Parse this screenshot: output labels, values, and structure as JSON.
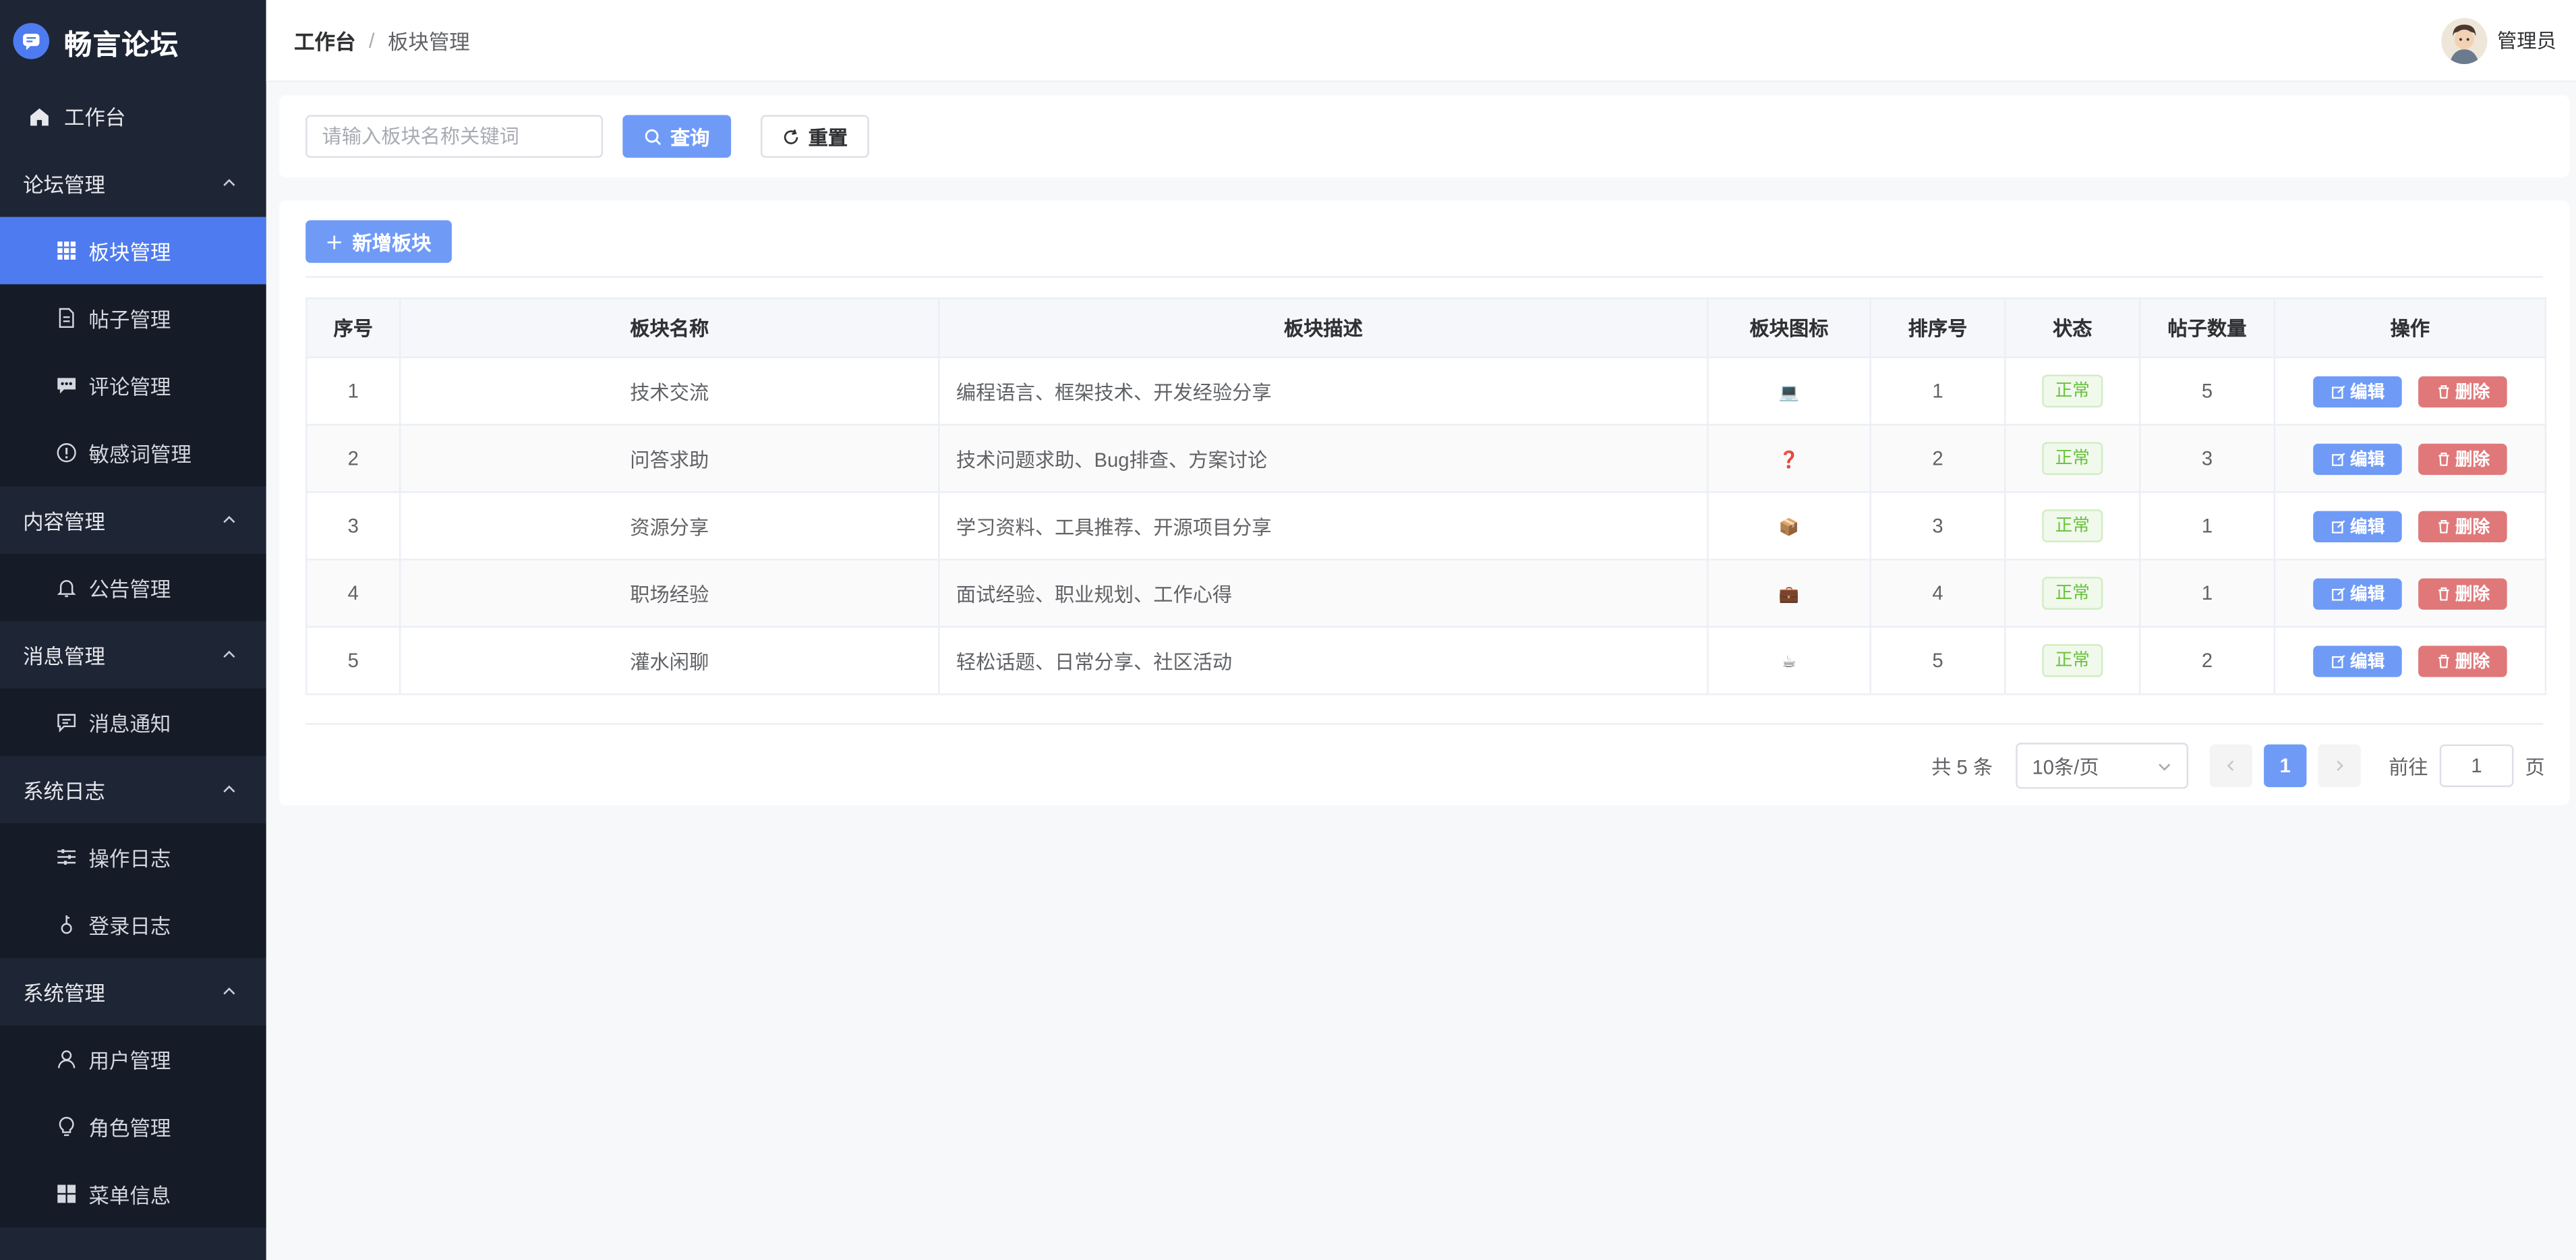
{
  "app": {
    "title": "畅言论坛",
    "brand_color": "#4f7bf0"
  },
  "sidebar": {
    "top_item": {
      "label": "工作台",
      "icon": "home-icon"
    },
    "groups": [
      {
        "label": "论坛管理",
        "items": [
          {
            "label": "板块管理",
            "icon": "grid-icon",
            "active": true
          },
          {
            "label": "帖子管理",
            "icon": "document-icon"
          },
          {
            "label": "评论管理",
            "icon": "comment-icon"
          },
          {
            "label": "敏感词管理",
            "icon": "warning-icon"
          }
        ]
      },
      {
        "label": "内容管理",
        "items": [
          {
            "label": "公告管理",
            "icon": "bell-icon"
          }
        ]
      },
      {
        "label": "消息管理",
        "items": [
          {
            "label": "消息通知",
            "icon": "message-icon"
          }
        ]
      },
      {
        "label": "系统日志",
        "items": [
          {
            "label": "操作日志",
            "icon": "sliders-icon"
          },
          {
            "label": "登录日志",
            "icon": "key-icon"
          }
        ]
      },
      {
        "label": "系统管理",
        "items": [
          {
            "label": "用户管理",
            "icon": "user-icon"
          },
          {
            "label": "角色管理",
            "icon": "bulb-icon"
          },
          {
            "label": "菜单信息",
            "icon": "menu-grid-icon"
          }
        ]
      }
    ]
  },
  "header": {
    "breadcrumb_home": "工作台",
    "breadcrumb_sep": "/",
    "breadcrumb_current": "板块管理",
    "username": "管理员"
  },
  "search": {
    "placeholder": "请输入板块名称关键词",
    "query_label": "查询",
    "reset_label": "重置"
  },
  "toolbar": {
    "add_label": "新增板块"
  },
  "table": {
    "columns": [
      "序号",
      "板块名称",
      "板块描述",
      "板块图标",
      "排序号",
      "状态",
      "帖子数量",
      "操作"
    ],
    "rows": [
      {
        "index": "1",
        "name": "技术交流",
        "description": "编程语言、框架技术、开发经验分享",
        "icon": "💻",
        "sort": "1",
        "status": "正常",
        "posts": "5"
      },
      {
        "index": "2",
        "name": "问答求助",
        "description": "技术问题求助、Bug排查、方案讨论",
        "icon": "❓",
        "sort": "2",
        "status": "正常",
        "posts": "3"
      },
      {
        "index": "3",
        "name": "资源分享",
        "description": "学习资料、工具推荐、开源项目分享",
        "icon": "📦",
        "sort": "3",
        "status": "正常",
        "posts": "1"
      },
      {
        "index": "4",
        "name": "职场经验",
        "description": "面试经验、职业规划、工作心得",
        "icon": "💼",
        "sort": "4",
        "status": "正常",
        "posts": "1"
      },
      {
        "index": "5",
        "name": "灌水闲聊",
        "description": "轻松话题、日常分享、社区活动",
        "icon": "☕",
        "sort": "5",
        "status": "正常",
        "posts": "2"
      }
    ],
    "edit_label": "编辑",
    "delete_label": "删除"
  },
  "pagination": {
    "total_text": "共 5 条",
    "page_size": "10条/页",
    "current_page": "1",
    "goto_prefix": "前往",
    "goto_value": "1",
    "goto_suffix": "页"
  }
}
